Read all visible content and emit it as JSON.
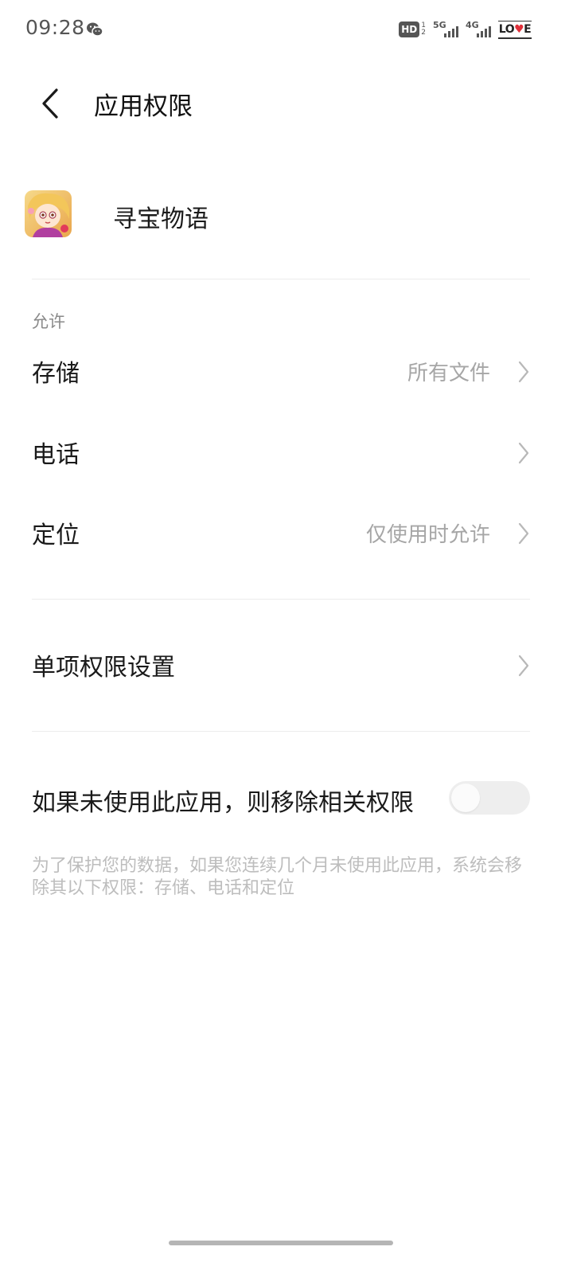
{
  "status_bar": {
    "time": "09:28",
    "hd": "HD",
    "hd_sub_top": "1",
    "hd_sub_bottom": "2",
    "network_1": "5G",
    "network_2": "4G",
    "battery_text_left": "LO",
    "battery_text_right": "E",
    "icons": [
      "wechat-icon",
      "signal-icon",
      "battery-icon"
    ]
  },
  "header": {
    "title": "应用权限",
    "back_icon": "chevron-left-icon"
  },
  "app": {
    "name": "寻宝物语"
  },
  "allowed_section": {
    "label": "允许",
    "items": [
      {
        "label": "存储",
        "value": "所有文件"
      },
      {
        "label": "电话",
        "value": ""
      },
      {
        "label": "定位",
        "value": "仅使用时允许"
      }
    ]
  },
  "individual_settings": {
    "label": "单项权限设置"
  },
  "auto_remove": {
    "label": "如果未使用此应用，则移除相关权限",
    "enabled": false,
    "note": "为了保护您的数据，如果您连续几个月未使用此应用，系统会移除其以下权限：存储、电话和定位"
  },
  "colors": {
    "text_primary": "#1a1a1a",
    "text_secondary": "#a6a6a6",
    "note_text": "#bdbdbd",
    "divider": "#ececec",
    "toggle_off": "#eeeeee"
  }
}
